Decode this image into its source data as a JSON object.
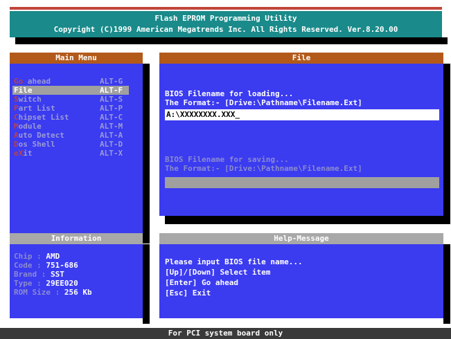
{
  "title": {
    "line1": "Flash EPROM Programming Utility",
    "line2": "Copyright (C)1999 American Megatrends Inc. All Rights Reserved. Ver.8.20.00"
  },
  "main_menu": {
    "header": "Main Menu",
    "items": [
      {
        "hot": "Go",
        "rest": " ahead",
        "key": "ALT-G",
        "selected": false
      },
      {
        "hot": "F",
        "rest": "ile",
        "key": "ALT-F",
        "selected": true
      },
      {
        "hot": "S",
        "rest": "witch",
        "key": "ALT-S",
        "selected": false
      },
      {
        "hot": "P",
        "rest": "art List",
        "key": "ALT-P",
        "selected": false
      },
      {
        "hot": "C",
        "rest": "hipset List",
        "key": "ALT-C",
        "selected": false
      },
      {
        "hot": "M",
        "rest": "odule",
        "key": "ALT-M",
        "selected": false
      },
      {
        "hot": "A",
        "rest": "uto Detect",
        "key": "ALT-A",
        "selected": false
      },
      {
        "hot": "D",
        "rest": "os Shell",
        "key": "ALT-D",
        "selected": false
      },
      {
        "hot": "eX",
        "rest": "it",
        "key": "ALT-X",
        "selected": false
      }
    ]
  },
  "file_panel": {
    "header": "File",
    "load_label": "BIOS Filename for loading...",
    "load_format": "The Format:-  [Drive:\\Pathname\\Filename.Ext]",
    "load_value": "A:\\XXXXXXXX.XXX_",
    "save_label": "BIOS Filename for saving...",
    "save_format": "The Format:-  [Drive:\\Pathname\\Filename.Ext]",
    "save_value": ""
  },
  "information": {
    "header": "Information",
    "rows": [
      {
        "key": "Chip  : ",
        "value": "AMD"
      },
      {
        "key": "Code  : ",
        "value": "751-686"
      },
      {
        "key": "Brand : ",
        "value": "SST"
      },
      {
        "key": "Type  : ",
        "value": "29EE020"
      },
      {
        "key": "ROM Size  : ",
        "value": "256 Kb"
      }
    ]
  },
  "help": {
    "header": "Help-Message",
    "lines": [
      "Please input BIOS file name...",
      "[Up]/[Down] Select item",
      "[Enter] Go ahead",
      "[Esc] Exit"
    ]
  },
  "status": {
    "text": "For PCI system board only"
  },
  "colors": {
    "panel_blue": "#3b3bf0",
    "title_teal": "#1a8a8a",
    "header_orange": "#b35a1a",
    "header_gray": "#a8a8a8"
  }
}
